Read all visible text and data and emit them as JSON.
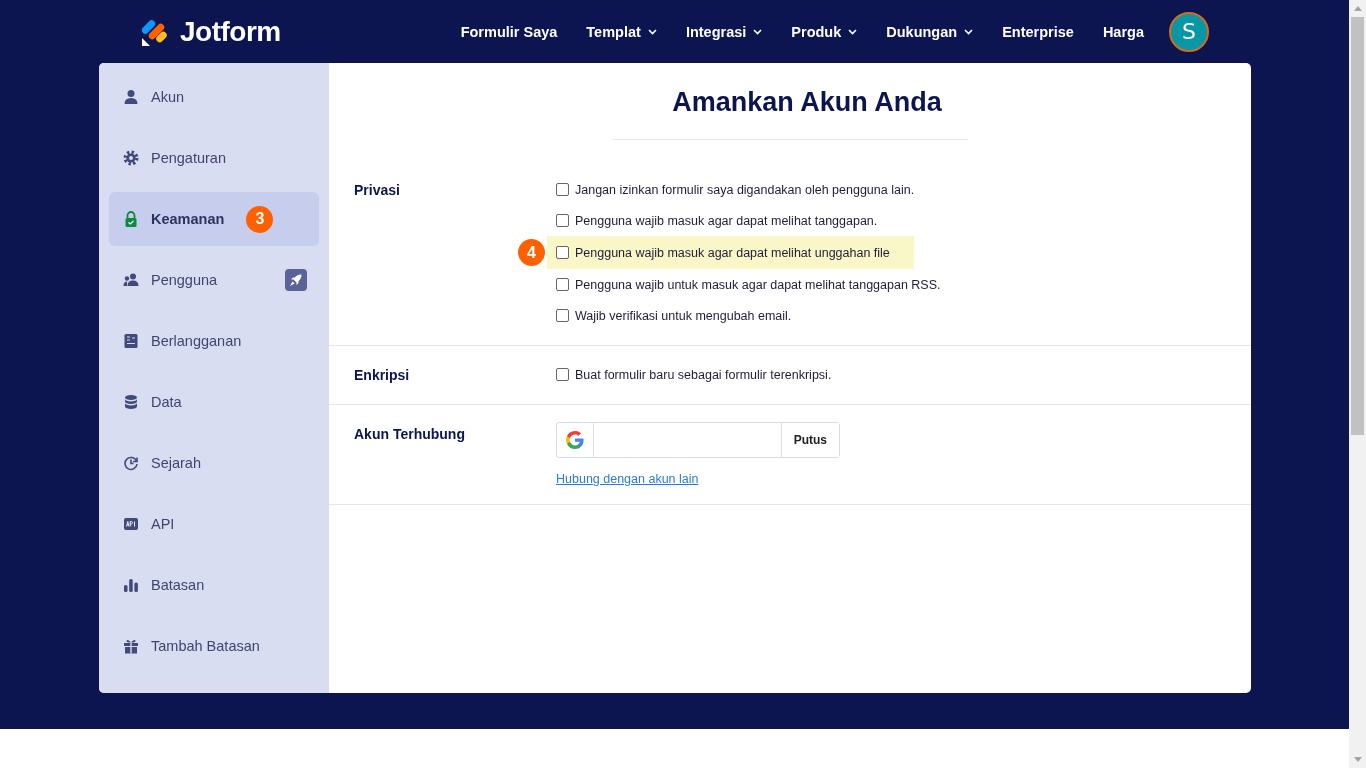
{
  "header": {
    "logo": "Jotform",
    "nav": [
      {
        "label": "Formulir Saya",
        "dropdown": false
      },
      {
        "label": "Templat",
        "dropdown": true
      },
      {
        "label": "Integrasi",
        "dropdown": true
      },
      {
        "label": "Produk",
        "dropdown": true
      },
      {
        "label": "Dukungan",
        "dropdown": true
      },
      {
        "label": "Enterprise",
        "dropdown": false
      },
      {
        "label": "Harga",
        "dropdown": false
      }
    ],
    "avatar": "S"
  },
  "sidebar": {
    "items": [
      {
        "kind": "user",
        "label": "Akun",
        "selected": false
      },
      {
        "kind": "gear",
        "label": "Pengaturan",
        "selected": false
      },
      {
        "kind": "lock",
        "label": "Keamanan",
        "selected": true,
        "step": "3"
      },
      {
        "kind": "users",
        "label": "Pengguna",
        "selected": false,
        "rocket": true
      },
      {
        "kind": "invoice",
        "label": "Berlangganan",
        "selected": false
      },
      {
        "kind": "database",
        "label": "Data",
        "selected": false
      },
      {
        "kind": "history",
        "label": "Sejarah",
        "selected": false
      },
      {
        "kind": "api",
        "label": "API",
        "selected": false
      },
      {
        "kind": "chart",
        "label": "Batasan",
        "selected": false
      },
      {
        "kind": "gift",
        "label": "Tambah Batasan",
        "selected": false
      }
    ]
  },
  "title": "Amankan Akun Anda",
  "sections": [
    {
      "kind": "checks",
      "label": "Privasi",
      "options": [
        {
          "label": "Jangan izinkan formulir saya digandakan oleh pengguna lain.",
          "checked": false,
          "highlighted": false
        },
        {
          "label": "Pengguna wajib masuk agar dapat melihat tanggapan.",
          "checked": false,
          "highlighted": false
        },
        {
          "label": "Pengguna wajib masuk agar dapat melihat unggahan file",
          "checked": false,
          "highlighted": true,
          "step": "4"
        },
        {
          "label": "Pengguna wajib untuk masuk agar dapat melihat tanggapan RSS.",
          "checked": false,
          "highlighted": false
        },
        {
          "label": "Wajib verifikasi untuk mengubah email.",
          "checked": false,
          "highlighted": false
        }
      ]
    },
    {
      "kind": "checks",
      "label": "Enkripsi",
      "options": [
        {
          "label": "Buat formulir baru sebagai formulir terenkripsi.",
          "checked": false,
          "highlighted": false
        }
      ]
    },
    {
      "kind": "accounts",
      "label": "Akun Terhubung",
      "button": "Putus",
      "link": "Hubung dengan akun lain"
    }
  ]
}
